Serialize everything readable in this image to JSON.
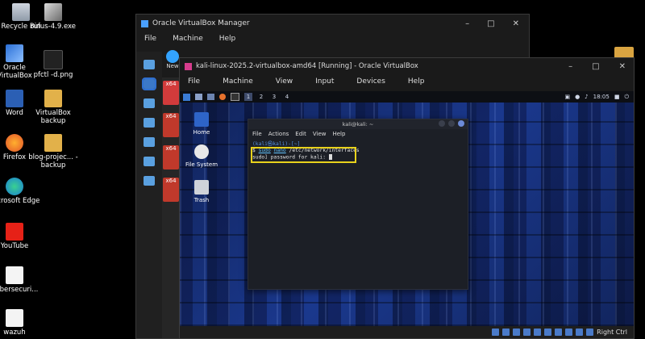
{
  "desktop": {
    "icons": [
      {
        "label": "Recycle Bin",
        "name": "recycle-bin"
      },
      {
        "label": "rufus-4.9.exe",
        "name": "rufus-exe"
      },
      {
        "label": "Oracle VirtualBox",
        "name": "oracle-virtualbox"
      },
      {
        "label": "pfctl -d.png",
        "name": "pfctl-png"
      },
      {
        "label": "Word",
        "name": "word"
      },
      {
        "label": "VirtualBox backup",
        "name": "virtualbox-backup"
      },
      {
        "label": "Firefox",
        "name": "firefox"
      },
      {
        "label": "blog-projec... - backup",
        "name": "blog-project-backup"
      },
      {
        "label": "Microsoft Edge",
        "name": "microsoft-edge"
      },
      {
        "label": "YouTube",
        "name": "youtube"
      },
      {
        "label": "Cybersecuri...",
        "name": "cybersecurity"
      },
      {
        "label": "wazuh",
        "name": "wazuh"
      }
    ]
  },
  "vbox_manager": {
    "title": "Oracle VirtualBox Manager",
    "menu": [
      "File",
      "Machine",
      "Help"
    ],
    "new_label": "New",
    "vm_badges": [
      "x64",
      "x64",
      "x64",
      "x64"
    ]
  },
  "kali_window": {
    "title": "kali-linux-2025.2-virtualbox-amd64 [Running] - Oracle VirtualBox",
    "menu": [
      "File",
      "Machine",
      "View",
      "Input",
      "Devices",
      "Help"
    ],
    "status_text": "Right Ctrl"
  },
  "guest": {
    "workspaces": [
      "1",
      "2",
      "3",
      "4"
    ],
    "clock": "18:05",
    "desktop_icons": [
      "Home",
      "File System",
      "Trash"
    ],
    "terminal": {
      "title": "kali@kali: ~",
      "menu": [
        "File",
        "Actions",
        "Edit",
        "View",
        "Help"
      ],
      "prompt": "(kali㉿kali)-[~]",
      "command_prefix": "$ ",
      "command_sudo": "sudo",
      "command_nano": "nano",
      "command_rest": " /etc/network/interfaces",
      "password_line": "sudo] password for kali: "
    }
  }
}
